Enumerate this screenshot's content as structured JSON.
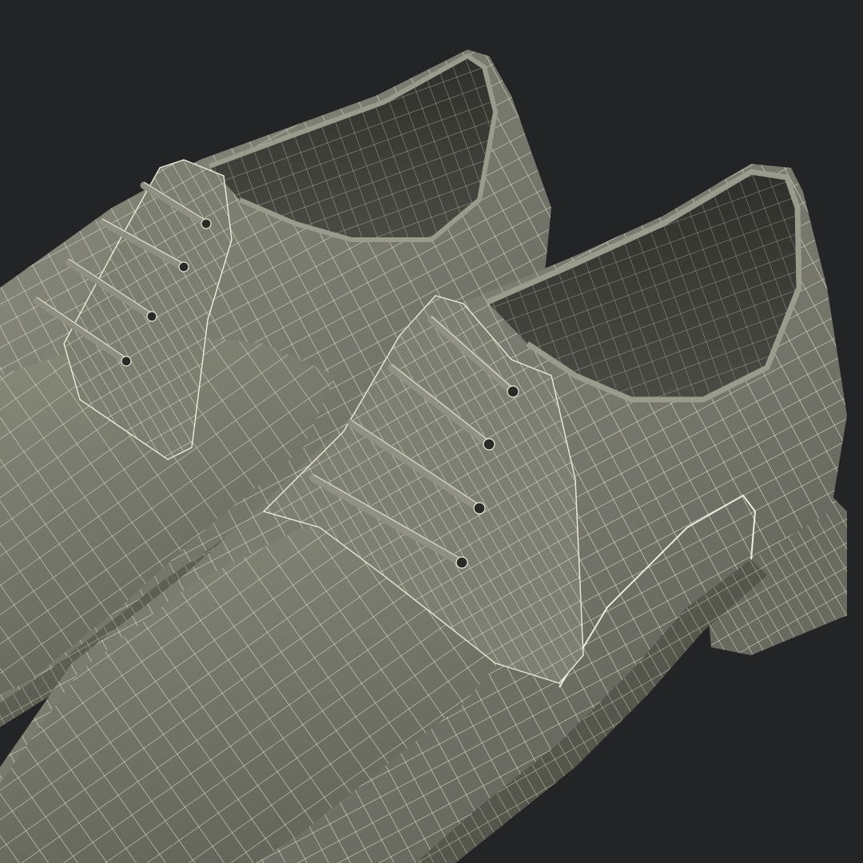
{
  "scene": {
    "subject": "pair-of-derby-shoes-wireframe-render",
    "colors": {
      "background": "#232425",
      "shell": "#77786c",
      "shell_light": "#8a8b7e",
      "shell_dark": "#54554b",
      "interior": "#3e3f38",
      "wire": "#ecebdc"
    }
  }
}
